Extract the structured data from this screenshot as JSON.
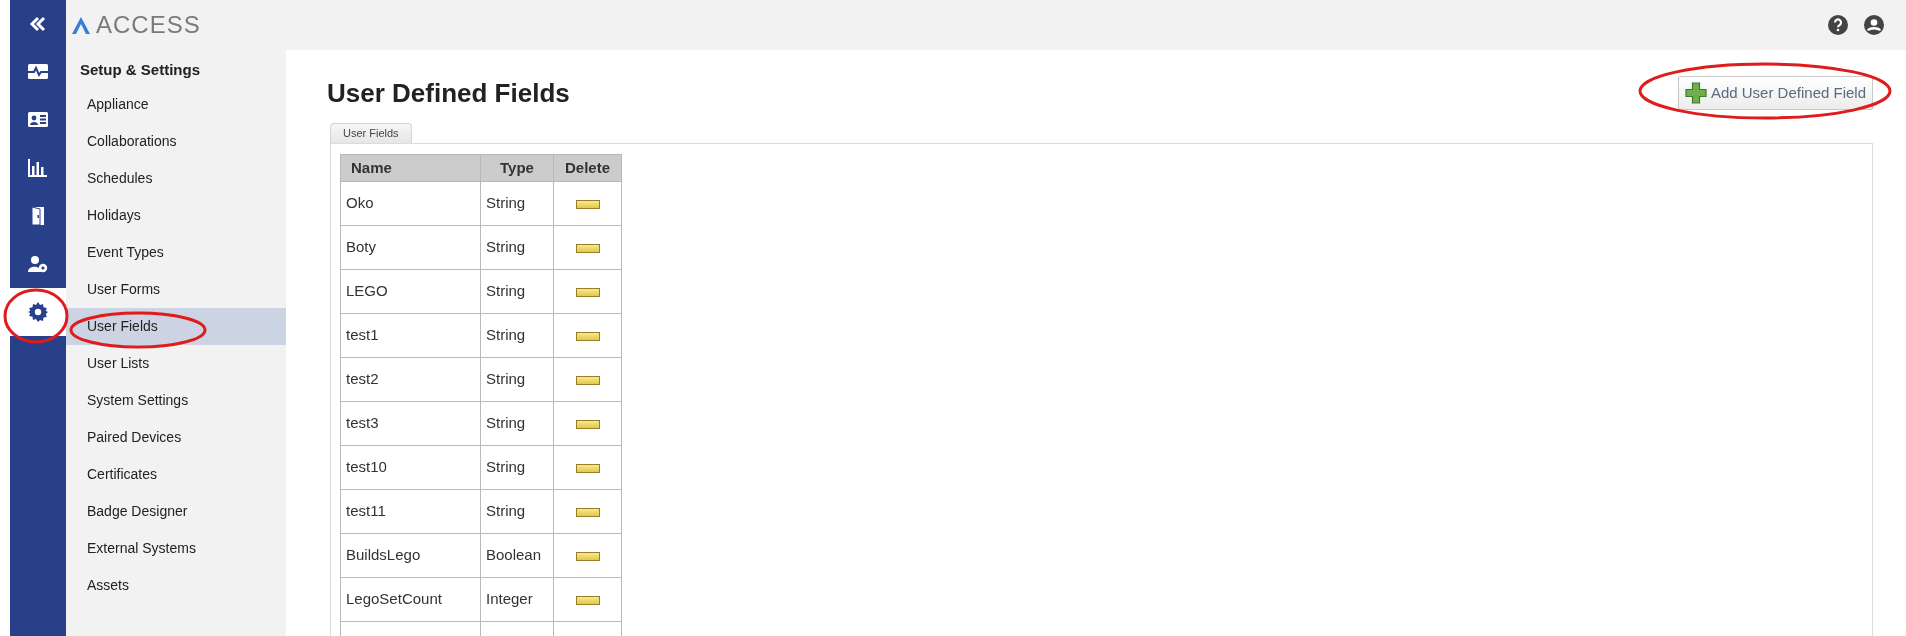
{
  "app": {
    "logo_text": "ACCESS"
  },
  "rail": [
    {
      "selected": false
    },
    {
      "selected": false
    },
    {
      "selected": false
    },
    {
      "selected": false
    },
    {
      "selected": false
    },
    {
      "selected": true
    }
  ],
  "sidebar": {
    "heading": "Setup & Settings",
    "items": [
      {
        "label": "Appliance",
        "selected": false
      },
      {
        "label": "Collaborations",
        "selected": false
      },
      {
        "label": "Schedules",
        "selected": false
      },
      {
        "label": "Holidays",
        "selected": false
      },
      {
        "label": "Event Types",
        "selected": false
      },
      {
        "label": "User Forms",
        "selected": false
      },
      {
        "label": "User Fields",
        "selected": true
      },
      {
        "label": "User Lists",
        "selected": false
      },
      {
        "label": "System Settings",
        "selected": false
      },
      {
        "label": "Paired Devices",
        "selected": false
      },
      {
        "label": "Certificates",
        "selected": false
      },
      {
        "label": "Badge Designer",
        "selected": false
      },
      {
        "label": "External Systems",
        "selected": false
      },
      {
        "label": "Assets",
        "selected": false
      }
    ]
  },
  "page": {
    "title": "User Defined Fields",
    "add_button": "Add User Defined Field"
  },
  "tabs": [
    {
      "label": "User Fields",
      "selected": true
    }
  ],
  "table": {
    "columns": [
      "Name",
      "Type",
      "Delete"
    ],
    "rows": [
      {
        "name": "Oko",
        "type": "String"
      },
      {
        "name": "Boty",
        "type": "String"
      },
      {
        "name": "LEGO",
        "type": "String"
      },
      {
        "name": "test1",
        "type": "String"
      },
      {
        "name": "test2",
        "type": "String"
      },
      {
        "name": "test3",
        "type": "String"
      },
      {
        "name": "test10",
        "type": "String"
      },
      {
        "name": "test11",
        "type": "String"
      },
      {
        "name": "BuildsLego",
        "type": "Boolean"
      },
      {
        "name": "LegoSetCount",
        "type": "Integer"
      }
    ]
  }
}
